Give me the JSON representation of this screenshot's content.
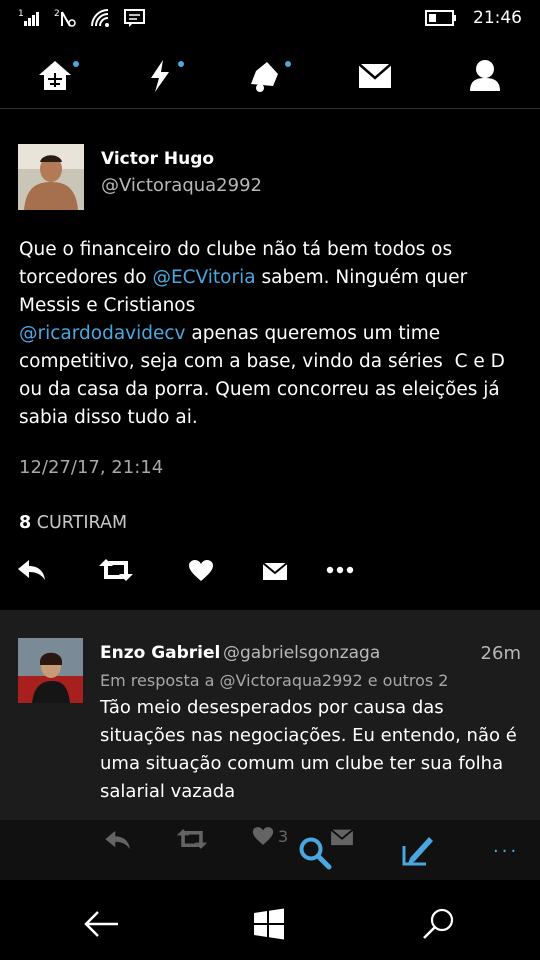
{
  "status_bar": {
    "sim1": "1",
    "sim2": "2",
    "time": "21:46",
    "icons": [
      "signal-icon",
      "sim2-signal-icon",
      "wifi-icon",
      "message-icon",
      "battery-icon"
    ]
  },
  "top_nav": {
    "items": [
      "home-icon",
      "lightning-icon",
      "bell-icon",
      "mail-icon",
      "profile-icon"
    ]
  },
  "tweet": {
    "name": "Victor Hugo",
    "handle": "@Victoraqua2992",
    "text_part1": "Que o financeiro do clube não tá bem todos os torcedores do ",
    "mention1": "@ECVitoria",
    "text_part2": " sabem. Ninguém quer Messis e Cristianos\n",
    "mention2": "@ricardodavidecv",
    "text_part3": " apenas queremos um time competitivo, seja com a base, vindo da séries  C e D ou da casa da porra. Quem concorreu as eleições já sabia disso tudo ai.",
    "timestamp": "12/27/17, 21:14",
    "likes_count": "8",
    "likes_label": "CURTIRAM"
  },
  "reply": {
    "name": "Enzo Gabriel",
    "handle": "@gabrielsgonzaga",
    "time": "26m",
    "reply_to_prefix": "Em resposta a ",
    "reply_to_user": "@Victoraqua2992",
    "reply_to_suffix": " e outros 2",
    "text": "Tão meio desesperados por causa das situações nas negociações. Eu entendo, não é uma situação comum um clube ter sua folha salarial vazada",
    "like_count": "3"
  },
  "app_bar": {
    "more_label": "..."
  },
  "colors": {
    "accent": "#4aa8e0",
    "background": "#000000",
    "reply_background": "#1c1c1c"
  }
}
